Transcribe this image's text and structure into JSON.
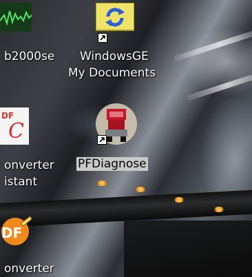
{
  "desktop": {
    "icons": [
      {
        "label": "b2000se",
        "kind": "audio-waveform-icon"
      },
      {
        "label_line1": "WindowsGE",
        "label_line2": "My Documents",
        "kind": "sync-folder-icon"
      },
      {
        "label": "PFDiagnose",
        "kind": "truck-icon",
        "selected": true
      },
      {
        "label_line1": "onverter",
        "label_line2": "istant",
        "kind": "pdf-converter-icon"
      },
      {
        "label": "onverter",
        "kind": "pdf-edit-icon"
      }
    ]
  },
  "colors": {
    "label_text": "#ffffff",
    "selected_label_bg": "#c9c9c9",
    "pdf_red": "#e0332c",
    "pdf_orange": "#f08a1c"
  }
}
